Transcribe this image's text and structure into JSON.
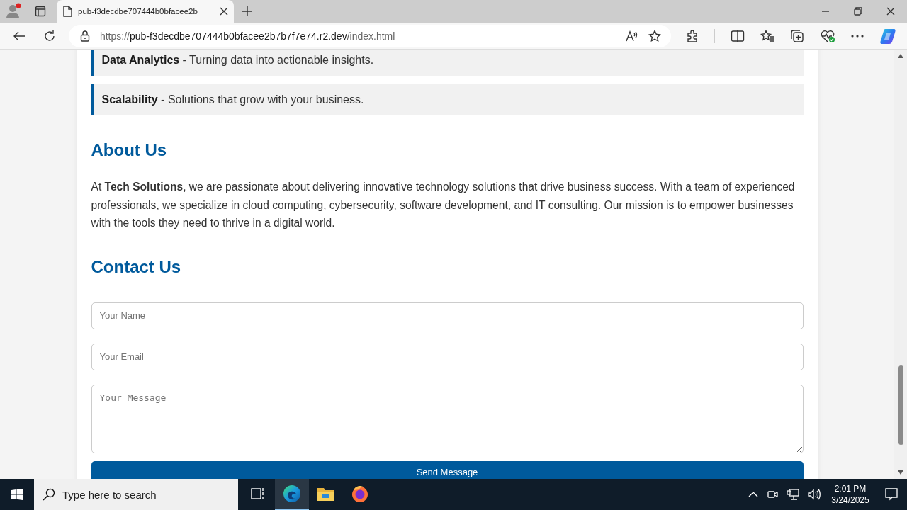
{
  "browser": {
    "tab": {
      "title": "pub-f3decdbe707444b0bfacee2b",
      "selected": true
    },
    "url": {
      "scheme": "https://",
      "host": "pub-f3decdbe707444b0bfacee2b7b7f7e74.r2.dev",
      "path": "/index.html"
    }
  },
  "features": [
    {
      "text": "**Data Analytics** - Turning data into actionable insights."
    },
    {
      "text": "**Scalability** - Solutions that grow with your business."
    }
  ],
  "about": {
    "heading": "About Us",
    "text": "At **Tech Solutions**, we are passionate about delivering innovative technology solutions that drive business success. With a team of experienced professionals, we specialize in cloud computing, cybersecurity, software development, and IT consulting. Our mission is to empower businesses with the tools they need to thrive in a digital world."
  },
  "contact": {
    "heading": "Contact Us",
    "fields": [
      {
        "kind": "input",
        "placeholder": "Your Name"
      },
      {
        "kind": "input",
        "placeholder": "Your Email"
      },
      {
        "kind": "textarea",
        "placeholder": "Your Message"
      }
    ],
    "button": "Send Message"
  },
  "taskbar": {
    "search_placeholder": "Type here to search",
    "apps": [
      {
        "kind": "taskview",
        "selected": false
      },
      {
        "kind": "edge",
        "selected": true
      },
      {
        "kind": "explorer",
        "selected": false
      },
      {
        "kind": "firefox",
        "selected": false
      }
    ],
    "time": "2:01 PM",
    "date": "3/24/2025"
  }
}
